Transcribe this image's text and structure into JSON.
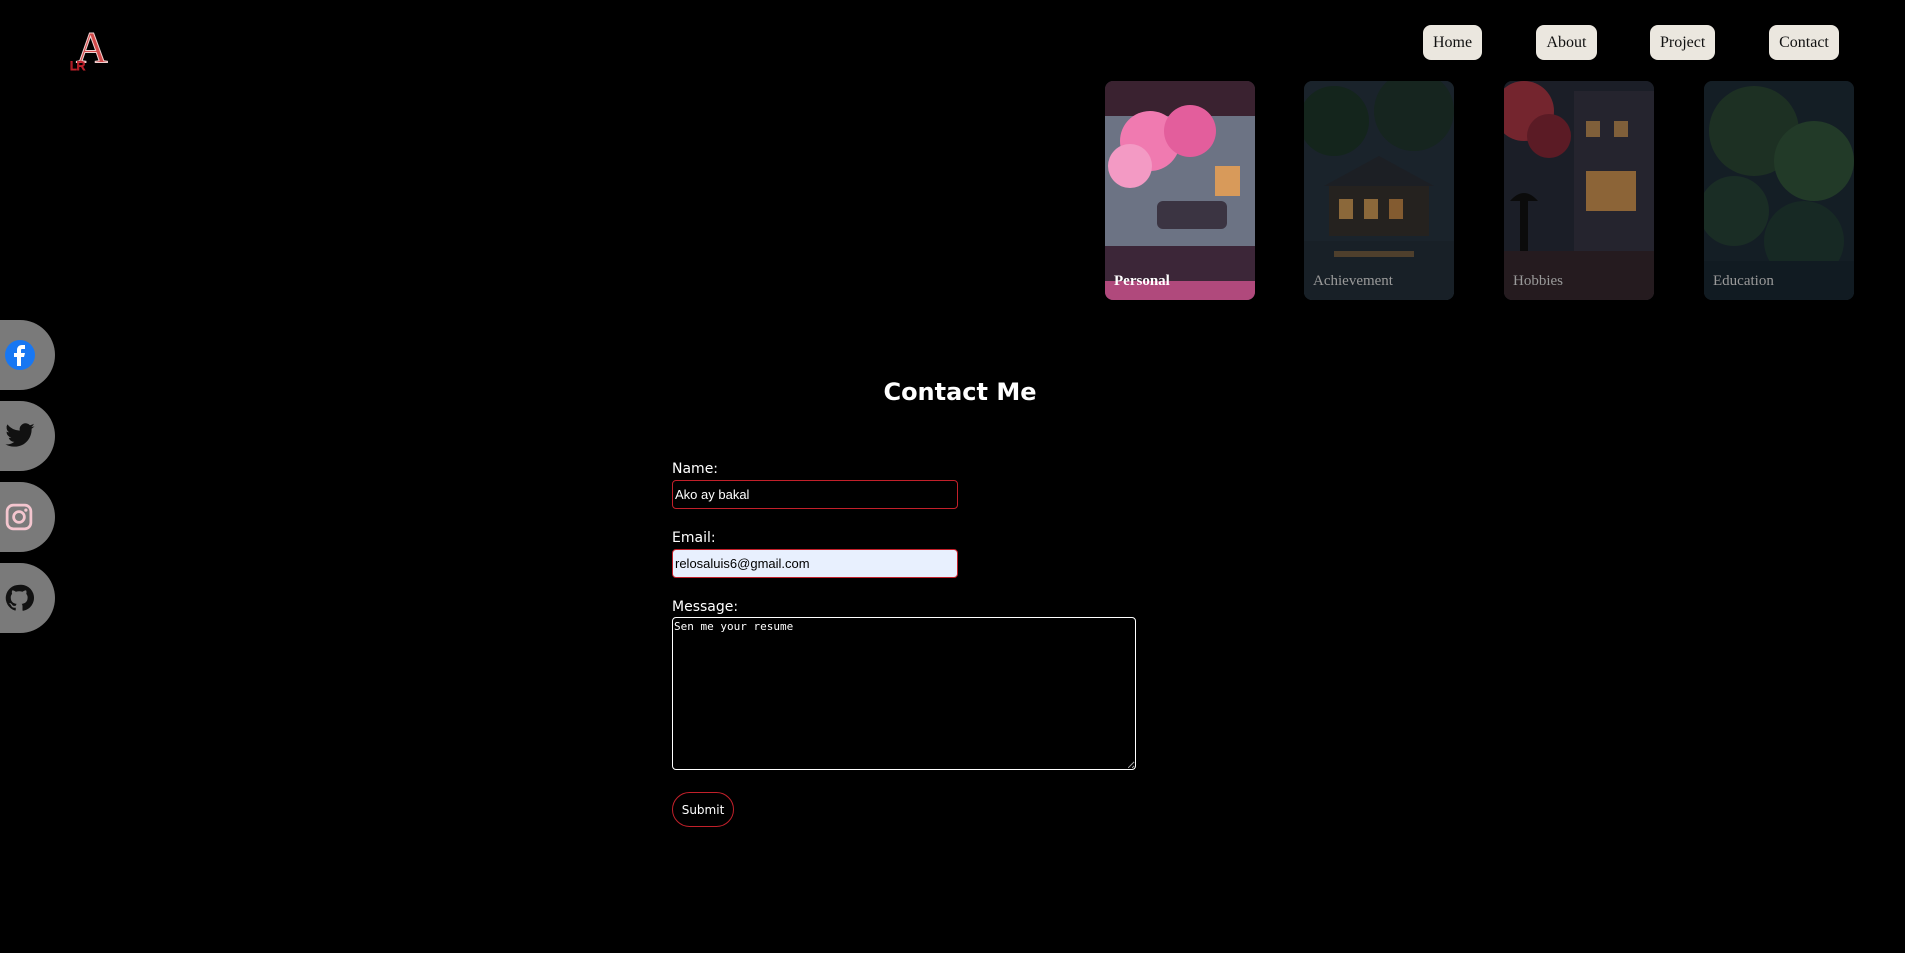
{
  "logo": {
    "text": "A",
    "sub_text": "LR"
  },
  "nav": [
    {
      "label": "Home",
      "name": "nav-home-button"
    },
    {
      "label": "About",
      "name": "nav-about-button"
    },
    {
      "label": "Project",
      "name": "nav-project-button"
    },
    {
      "label": "Contact",
      "name": "nav-contact-button"
    }
  ],
  "cards": [
    {
      "label": "Personal",
      "active": true
    },
    {
      "label": "Achievement",
      "active": false
    },
    {
      "label": "Hobbies",
      "active": false
    },
    {
      "label": "Education",
      "active": false
    }
  ],
  "social": [
    {
      "icon": "facebook-icon",
      "color": "#1877f2"
    },
    {
      "icon": "twitter-icon",
      "color": "#111111"
    },
    {
      "icon": "instagram-icon",
      "color": "#f4c6cf"
    },
    {
      "icon": "github-icon",
      "color": "#111111"
    }
  ],
  "contact": {
    "title": "Contact Me",
    "name_label": "Name:",
    "name_value": "Ako ay bakal",
    "email_label": "Email:",
    "email_value": "relosaluis6@gmail.com",
    "message_label": "Message:",
    "message_value": "Sen me your resume",
    "submit_label": "Submit"
  },
  "colors": {
    "accent": "#c2202a",
    "background": "#000000",
    "nav_button": "#ebe7df"
  }
}
